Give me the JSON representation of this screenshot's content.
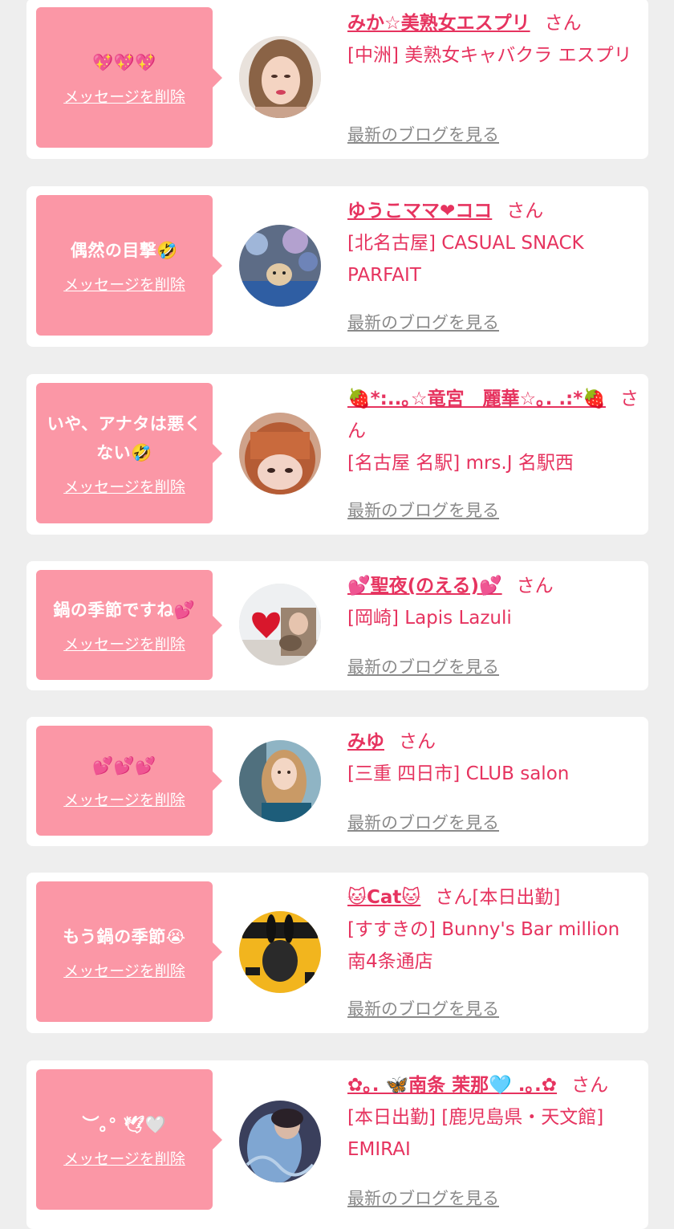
{
  "delete_label": "メッセージを削除",
  "san_label": "さん",
  "blog_label": "最新のブログを見る",
  "colors": {
    "page_bg": "#eeeeee",
    "card_bg": "#ffffff",
    "bubble_bg": "#fb97a6",
    "name_color": "#e6335f",
    "blog_link_color": "#8a8a8a"
  },
  "cards": [
    {
      "message": "💖💖💖",
      "name": "みか☆美熟女エスプリ",
      "name_suffix": "",
      "shop": "[中洲] 美熟女キャバクラ エスプリ",
      "avatar_icon": "woman-portrait-photo"
    },
    {
      "message": "偶然の目撃🤣",
      "name": "ゆうこママ❤ココ",
      "name_suffix": "",
      "shop": "[北名古屋] CASUAL SNACK PARFAIT",
      "avatar_icon": "dog-with-balloons-photo"
    },
    {
      "message": "いや、アナタは悪くない🤣",
      "name": "🍓*:..｡☆竜宮　麗華☆｡. .:*🍓",
      "name_suffix": "",
      "shop": "[名古屋 名駅] mrs.J 名駅西",
      "avatar_icon": "woman-with-bangs-photo"
    },
    {
      "message": "鍋の季節ですね💕",
      "name": "💕聖夜(のえる)💕",
      "name_suffix": "",
      "shop": "[岡崎] Lapis Lazuli",
      "avatar_icon": "heart-and-woman-photo"
    },
    {
      "message": "💕💕💕",
      "name": "みゆ",
      "name_suffix": "",
      "shop": "[三重 四日市] CLUB salon",
      "avatar_icon": "woman-blue-dress-photo"
    },
    {
      "message": "もう鍋の季節😭",
      "name": "🐱Cat🐱",
      "name_suffix": "[本日出勤]",
      "shop": "[すすきの] Bunny's Bar million 南4条通店",
      "avatar_icon": "bunny-magazine-cover-photo"
    },
    {
      "message": "︶｡° 🕊🤍",
      "name": "✿｡. 🦋南条 茉那🩵 .｡.✿",
      "name_suffix": "",
      "shop": "[本日出勤] [鹿児島県・天文館] EMIRAI",
      "avatar_icon": "woman-lace-dress-photo"
    }
  ]
}
